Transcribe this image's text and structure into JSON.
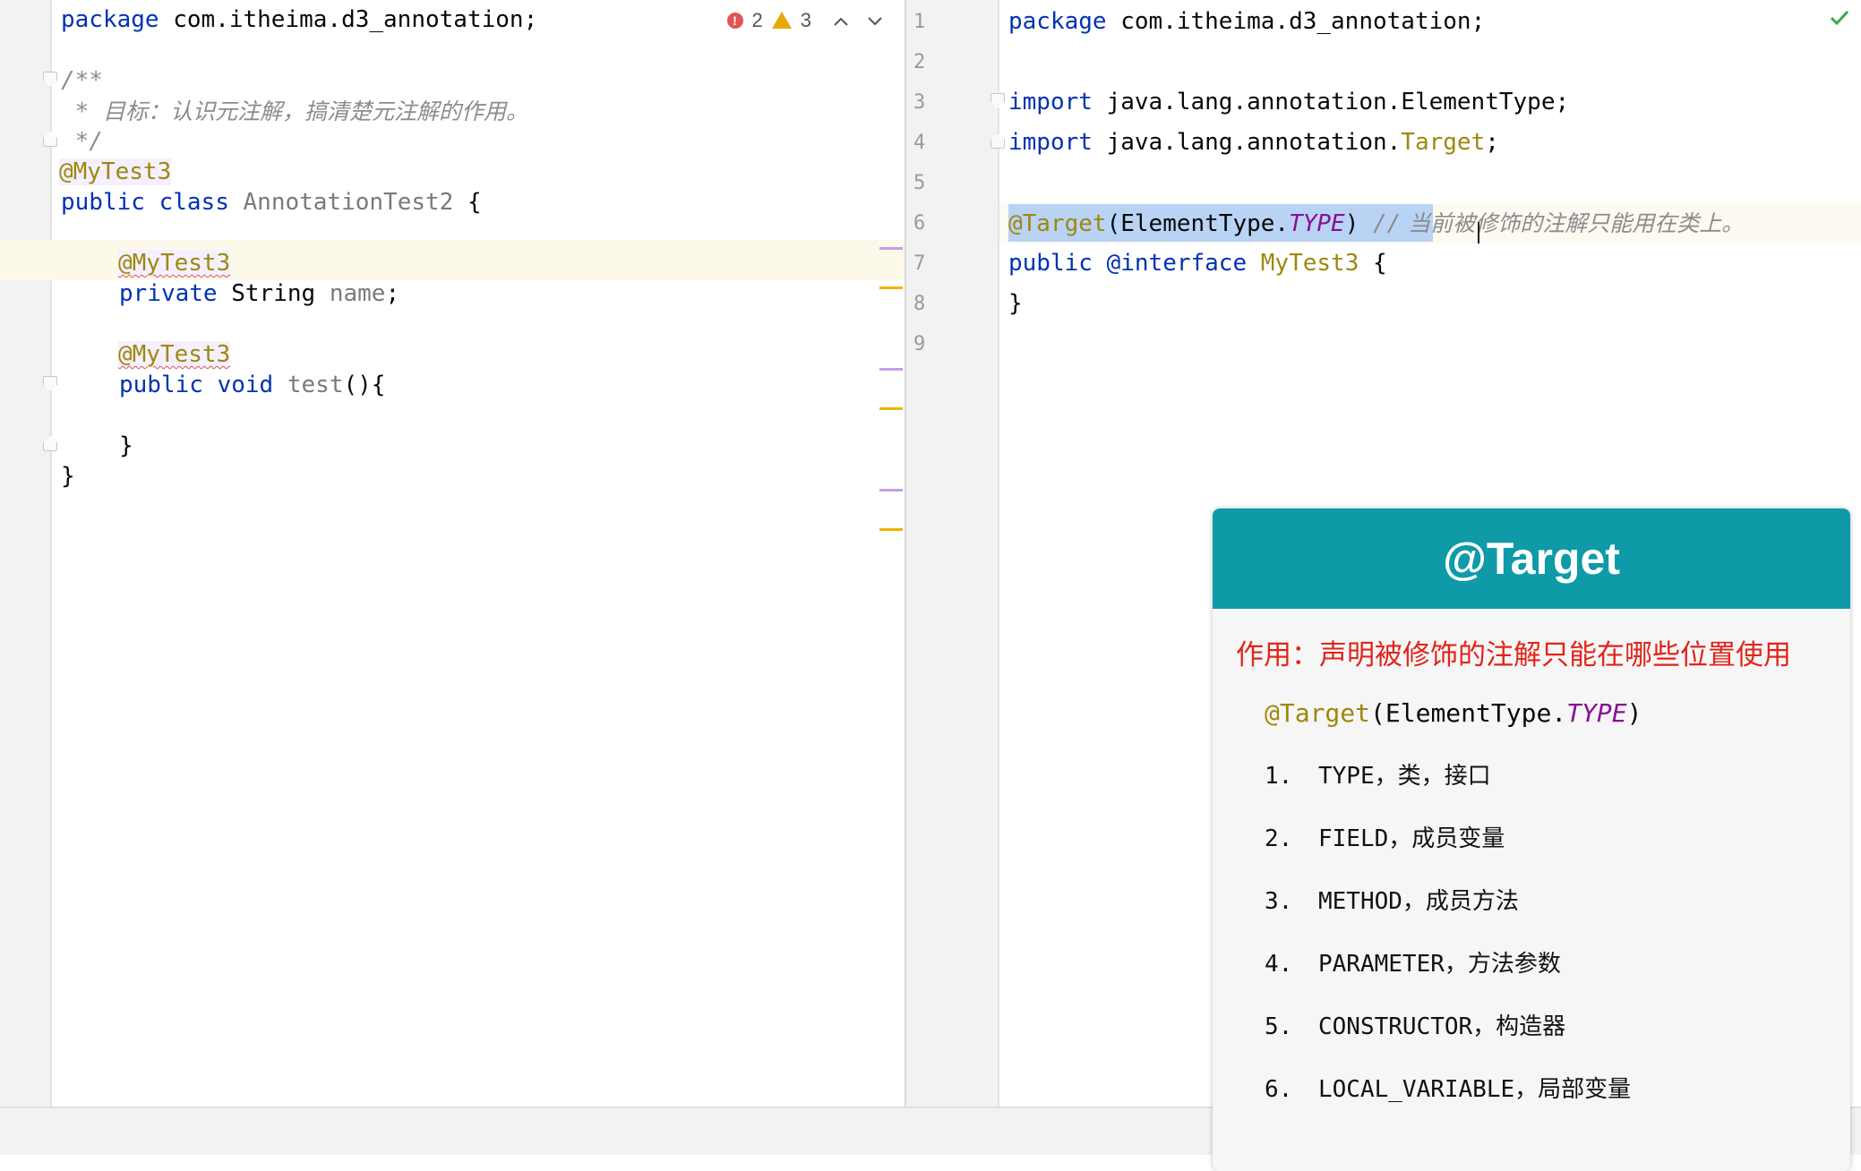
{
  "left_editor": {
    "lines": {
      "l1": {
        "kw": "package",
        "rest": " com.itheima.d3_annotation;"
      },
      "l3": "/**",
      "l4_prefix": " * ",
      "l4_text": "目标：认识元注解，搞清楚元注解的作用。",
      "l5": " */",
      "l6": "@MyTest3",
      "l7": {
        "kw1": "public",
        "kw2": "class",
        "name": "AnnotationTest2",
        "brace": " {"
      },
      "l9": "@MyTest3",
      "l10": {
        "kw": "private",
        "type": "String",
        "name": "name",
        "end": ";"
      },
      "l12": "@MyTest3",
      "l13": {
        "kw1": "public",
        "kw2": "void",
        "name": "test",
        "end": "(){"
      },
      "l15": "}",
      "l16": "}"
    },
    "inspection": {
      "errors": "2",
      "warnings": "3"
    }
  },
  "right_editor": {
    "line_numbers": [
      "1",
      "2",
      "3",
      "4",
      "5",
      "6",
      "7",
      "8",
      "9"
    ],
    "lines": {
      "l1": {
        "kw": "package",
        "rest": " com.itheima.d3_annotation;"
      },
      "l3": {
        "kw": "import",
        "rest": " java.lang.annotation.ElementType;"
      },
      "l4": {
        "kw": "import",
        "rest": " java.lang.annotation.",
        "target": "Target",
        "end": ";"
      },
      "l6": {
        "ann": "@Target",
        "open": "(ElementType.",
        "const": "TYPE",
        "close": ")",
        "slashes": " //",
        "comment": " 当前被修饰的注解只能用在类上。"
      },
      "l7": {
        "kw": "public",
        "ann": "@interface",
        "name": "MyTest3",
        "brace": " {"
      },
      "l8": "}"
    }
  },
  "card": {
    "title": "@Target",
    "purpose": "作用：声明被修饰的注解只能在哪些位置使用",
    "code": {
      "ann": "@Target",
      "open": "(ElementType.",
      "const": "TYPE",
      "close": ")"
    },
    "items": [
      {
        "num": "1.",
        "text": "TYPE，类，接口"
      },
      {
        "num": "2.",
        "text": "FIELD，成员变量"
      },
      {
        "num": "3.",
        "text": "METHOD，成员方法"
      },
      {
        "num": "4.",
        "text": "PARAMETER，方法参数"
      },
      {
        "num": "5.",
        "text": "CONSTRUCTOR，构造器"
      },
      {
        "num": "6.",
        "text": "LOCAL_VARIABLE，局部变量"
      }
    ]
  },
  "colors": {
    "header_teal": "#0f9aa8",
    "purpose_red": "#e0251b",
    "keyword_blue": "#0033b3",
    "annotation_gold": "#9e880d"
  },
  "icons": [
    "error-icon",
    "warning-icon",
    "chevron-up-icon",
    "chevron-down-icon",
    "check-icon",
    "fold-marker-icon"
  ]
}
